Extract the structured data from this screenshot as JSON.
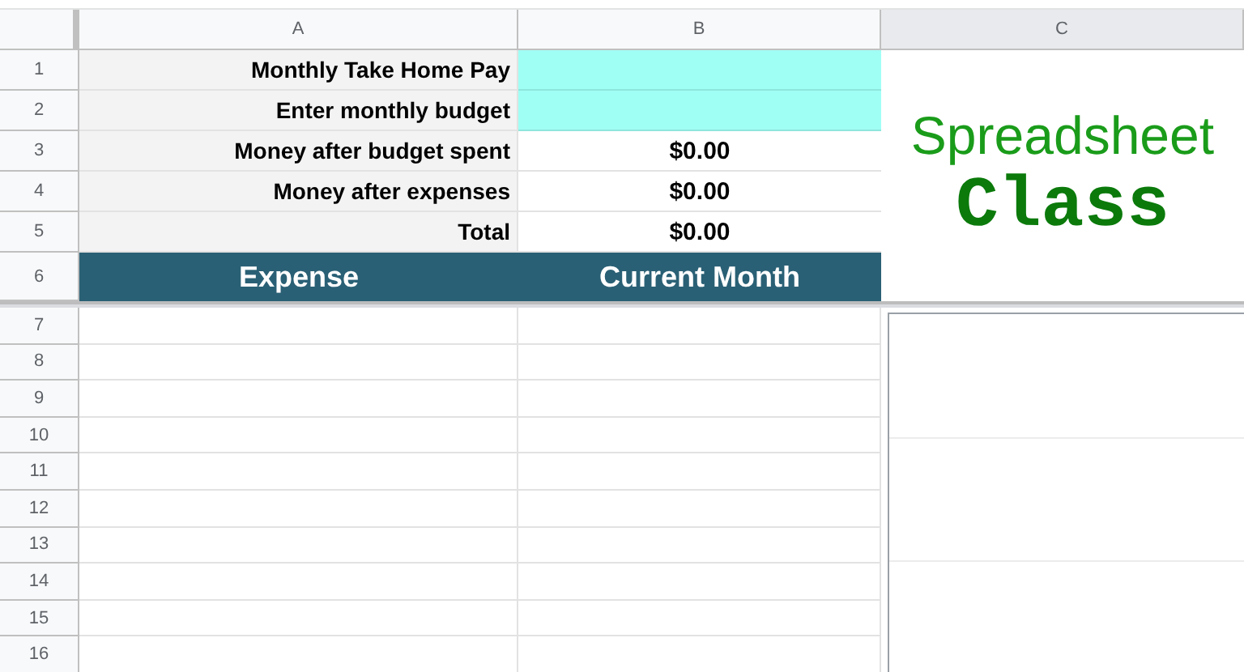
{
  "column_headers": [
    "A",
    "B",
    "C"
  ],
  "rows": [
    {
      "number": "1",
      "kind": "input",
      "label": "Monthly Take Home Pay"
    },
    {
      "number": "2",
      "kind": "input",
      "label": "Enter monthly budget"
    },
    {
      "number": "3",
      "kind": "result",
      "label": "Money after budget spent",
      "value": "$0.00"
    },
    {
      "number": "4",
      "kind": "result",
      "label": "Money after expenses",
      "value": "$0.00"
    },
    {
      "number": "5",
      "kind": "result",
      "label": "Total",
      "value": "$0.00"
    },
    {
      "number": "6",
      "kind": "header",
      "label": "Expense",
      "value": "Current Month"
    }
  ],
  "logo": {
    "line_1": "Spreadsheet",
    "line_2": "Class"
  },
  "empty_rows": [
    "7",
    "8",
    "9",
    "10",
    "11",
    "12",
    "13",
    "14",
    "15",
    "16"
  ]
}
